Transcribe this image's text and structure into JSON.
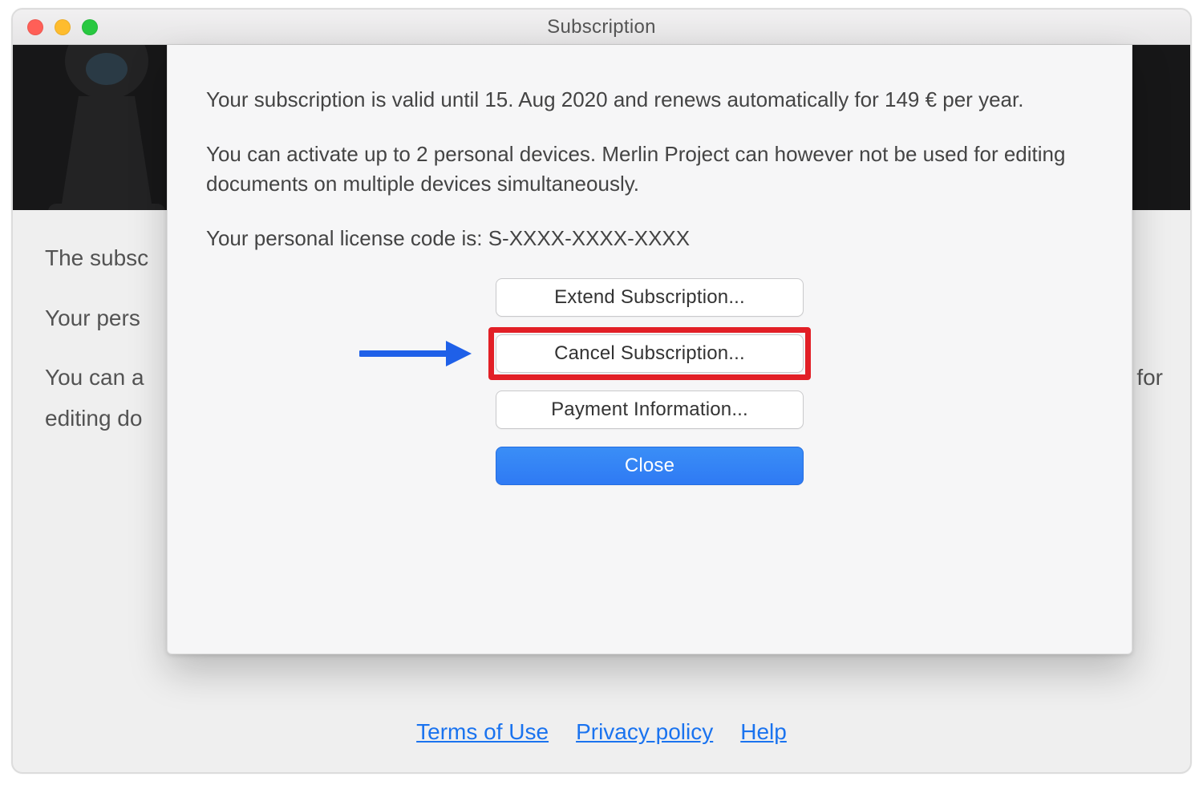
{
  "window": {
    "title": "Subscription"
  },
  "sheet": {
    "paragraph1": "Your subscription is valid until 15. Aug 2020 and renews automatically for 149 € per year.",
    "paragraph2": "You can activate up to 2 personal devices. Merlin Project can however not be used for editing documents on multiple devices simultaneously.",
    "paragraph3": "Your personal license code is: S-XXXX-XXXX-XXXX",
    "buttons": {
      "extend": "Extend Subscription...",
      "cancel": "Cancel Subscription...",
      "payment": "Payment Information...",
      "close": "Close"
    }
  },
  "background": {
    "line1": "The subsc",
    "line2": "Your pers",
    "line3_a": "You can a",
    "line3_b": "for",
    "line4": "editing do"
  },
  "footer": {
    "terms": "Terms of Use",
    "privacy": "Privacy policy",
    "help": "Help"
  },
  "icons": {
    "chess": "chess-pawn"
  }
}
